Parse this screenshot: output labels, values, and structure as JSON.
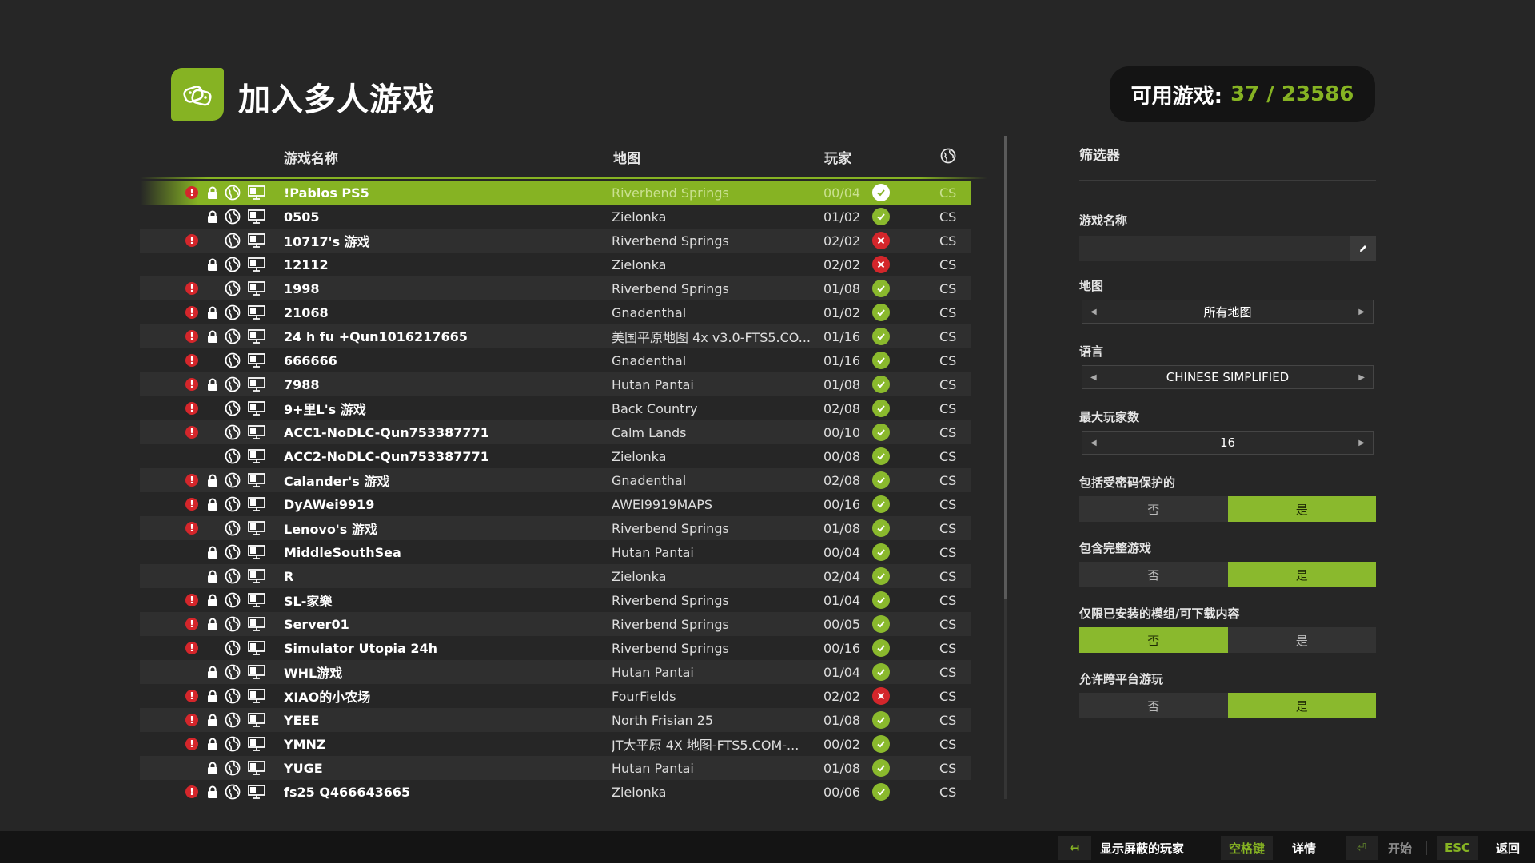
{
  "header": {
    "title": "加入多人游戏",
    "icon": "multiplayer-gamepad-icon",
    "count_label": "可用游戏:",
    "count_value": "37 / 23586"
  },
  "table": {
    "columns": {
      "name": "游戏名称",
      "map": "地图",
      "players": "玩家",
      "language_icon": "globe-icon"
    },
    "rows": [
      {
        "warn": true,
        "lock": true,
        "name": "!Pablos PS5",
        "map": "Riverbend Springs",
        "players": "00/04",
        "status": "ok",
        "lang": "CS",
        "selected": true
      },
      {
        "warn": false,
        "lock": true,
        "name": "0505",
        "map": "Zielonka",
        "players": "01/02",
        "status": "ok",
        "lang": "CS"
      },
      {
        "warn": true,
        "lock": false,
        "name": "10717's 游戏",
        "map": "Riverbend Springs",
        "players": "02/02",
        "status": "full",
        "lang": "CS"
      },
      {
        "warn": false,
        "lock": true,
        "name": "12112",
        "map": "Zielonka",
        "players": "02/02",
        "status": "full",
        "lang": "CS"
      },
      {
        "warn": true,
        "lock": false,
        "name": "1998",
        "map": "Riverbend Springs",
        "players": "01/08",
        "status": "ok",
        "lang": "CS"
      },
      {
        "warn": true,
        "lock": true,
        "name": "21068",
        "map": "Gnadenthal",
        "players": "01/02",
        "status": "ok",
        "lang": "CS"
      },
      {
        "warn": true,
        "lock": true,
        "name": "24 h fu +Qun1016217665",
        "map": "美国平原地图 4x v3.0-FTS5.CO...",
        "players": "01/16",
        "status": "ok",
        "lang": "CS"
      },
      {
        "warn": true,
        "lock": false,
        "name": "666666",
        "map": "Gnadenthal",
        "players": "01/16",
        "status": "ok",
        "lang": "CS"
      },
      {
        "warn": true,
        "lock": true,
        "name": "7988",
        "map": "Hutan Pantai",
        "players": "01/08",
        "status": "ok",
        "lang": "CS"
      },
      {
        "warn": true,
        "lock": false,
        "name": "9+里L's 游戏",
        "map": "Back Country",
        "players": "02/08",
        "status": "ok",
        "lang": "CS"
      },
      {
        "warn": true,
        "lock": false,
        "name": "ACC1-NoDLC-Qun753387771",
        "map": "Calm Lands",
        "players": "00/10",
        "status": "ok",
        "lang": "CS"
      },
      {
        "warn": false,
        "lock": false,
        "name": "ACC2-NoDLC-Qun753387771",
        "map": "Zielonka",
        "players": "00/08",
        "status": "ok",
        "lang": "CS"
      },
      {
        "warn": true,
        "lock": true,
        "name": "Calander's 游戏",
        "map": "Gnadenthal",
        "players": "02/08",
        "status": "ok",
        "lang": "CS"
      },
      {
        "warn": true,
        "lock": true,
        "name": "DyAWei9919",
        "map": "AWEI9919MAPS",
        "players": "00/16",
        "status": "ok",
        "lang": "CS"
      },
      {
        "warn": true,
        "lock": false,
        "name": "Lenovo's 游戏",
        "map": "Riverbend Springs",
        "players": "01/08",
        "status": "ok",
        "lang": "CS"
      },
      {
        "warn": false,
        "lock": true,
        "name": "MiddleSouthSea",
        "map": "Hutan Pantai",
        "players": "00/04",
        "status": "ok",
        "lang": "CS"
      },
      {
        "warn": false,
        "lock": true,
        "name": "R",
        "map": "Zielonka",
        "players": "02/04",
        "status": "ok",
        "lang": "CS"
      },
      {
        "warn": true,
        "lock": true,
        "name": "SL-家樂",
        "map": "Riverbend Springs",
        "players": "01/04",
        "status": "ok",
        "lang": "CS"
      },
      {
        "warn": true,
        "lock": true,
        "name": "Server01",
        "map": "Riverbend Springs",
        "players": "00/05",
        "status": "ok",
        "lang": "CS"
      },
      {
        "warn": true,
        "lock": false,
        "name": "Simulator Utopia 24h",
        "map": "Riverbend Springs",
        "players": "00/16",
        "status": "ok",
        "lang": "CS"
      },
      {
        "warn": false,
        "lock": true,
        "name": "WHL游戏",
        "map": "Hutan Pantai",
        "players": "01/04",
        "status": "ok",
        "lang": "CS"
      },
      {
        "warn": true,
        "lock": true,
        "name": "XIAO的小农场",
        "map": "FourFields",
        "players": "02/02",
        "status": "full",
        "lang": "CS"
      },
      {
        "warn": true,
        "lock": true,
        "name": "YEEE",
        "map": "North Frisian 25",
        "players": "01/08",
        "status": "ok",
        "lang": "CS"
      },
      {
        "warn": true,
        "lock": true,
        "name": "YMNZ",
        "map": "JT大平原 4X 地图-FTS5.COM-...",
        "players": "00/02",
        "status": "ok",
        "lang": "CS"
      },
      {
        "warn": false,
        "lock": true,
        "name": "YUGE",
        "map": "Hutan Pantai",
        "players": "01/08",
        "status": "ok",
        "lang": "CS"
      },
      {
        "warn": true,
        "lock": true,
        "name": "fs25 Q466643665",
        "map": "Zielonka",
        "players": "00/06",
        "status": "ok",
        "lang": "CS"
      }
    ]
  },
  "filters": {
    "title": "筛选器",
    "game_name": {
      "label": "游戏名称",
      "value": "",
      "edit_icon": "pencil-icon"
    },
    "map": {
      "label": "地图",
      "value": "所有地图"
    },
    "language": {
      "label": "语言",
      "value": "CHINESE SIMPLIFIED"
    },
    "max_players": {
      "label": "最大玩家数",
      "value": "16"
    },
    "password": {
      "label": "包括受密码保护的",
      "no": "否",
      "yes": "是",
      "selected": "yes"
    },
    "full_games": {
      "label": "包含完整游戏",
      "no": "否",
      "yes": "是",
      "selected": "yes"
    },
    "installed_mods": {
      "label": "仅限已安装的模组/可下载内容",
      "no": "否",
      "yes": "是",
      "selected": "no"
    },
    "crossplay": {
      "label": "允许跨平台游玩",
      "no": "否",
      "yes": "是",
      "selected": "yes"
    }
  },
  "footer": {
    "show_blocked_key": "↤",
    "show_blocked_label": "显示屏蔽的玩家",
    "details_key": "空格键",
    "details_label": "详情",
    "start_key": "⏎",
    "start_label": "开始",
    "back_key": "ESC",
    "back_label": "返回"
  },
  "colors": {
    "accent": "#86b323",
    "background": "#262626",
    "error": "#d4262b"
  }
}
